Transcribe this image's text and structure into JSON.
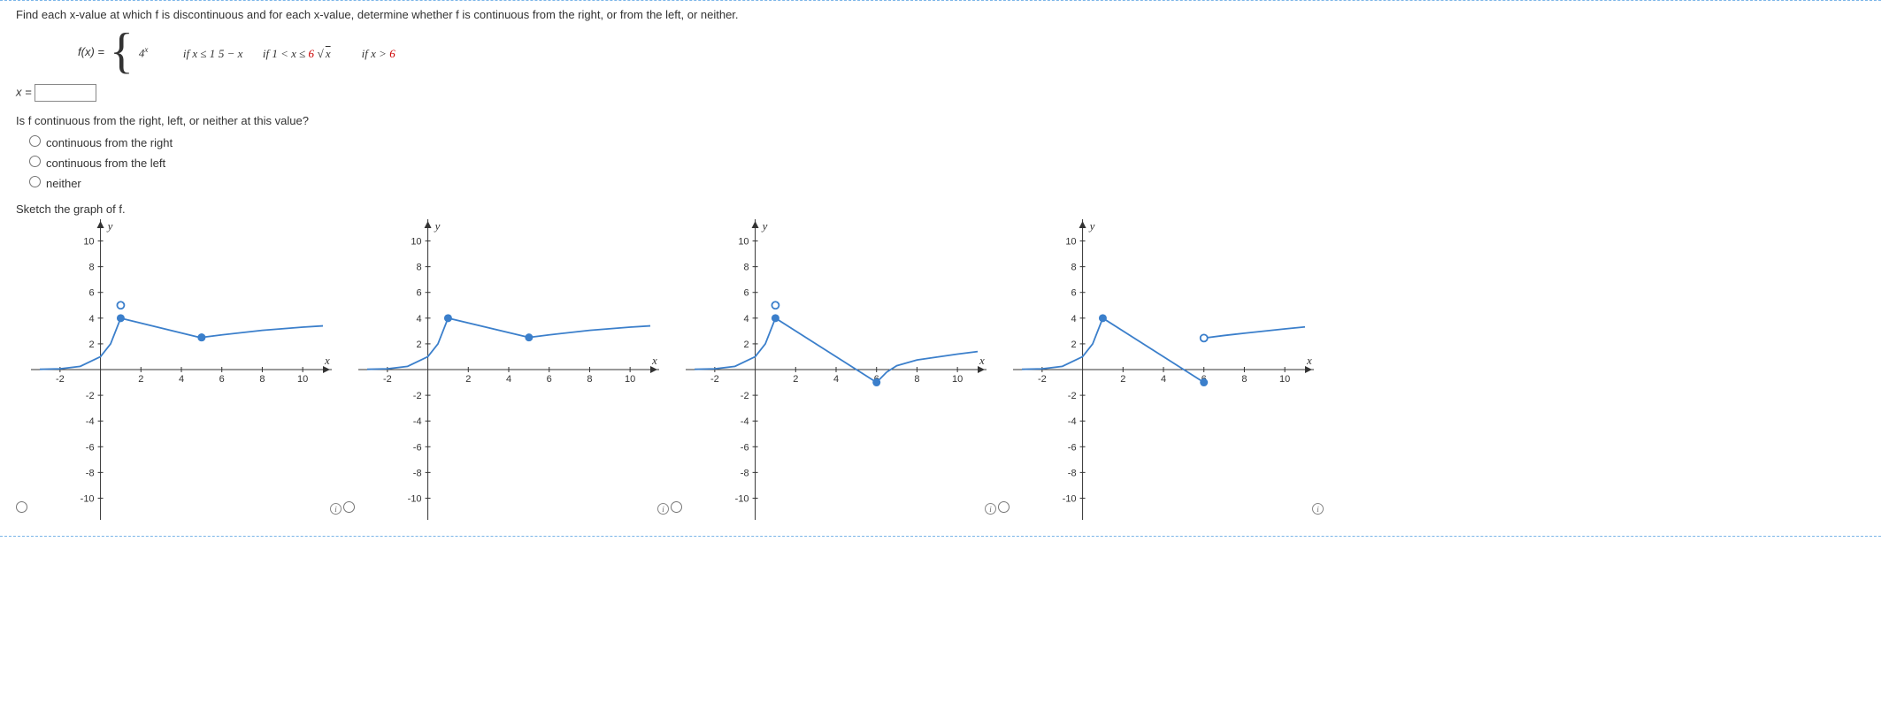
{
  "prompt": "Find each x-value at which f is discontinuous and for each x-value, determine whether f is continuous from the right, or from the left, or neither.",
  "function": {
    "label": "f(x) = ",
    "pieces": [
      {
        "expr_html": "4<span class='sup'>x</span>",
        "cond": "if x ≤ 1"
      },
      {
        "expr_html": "5 − x",
        "cond_html": "if 1 < x ≤ <span class='red'>6</span>"
      },
      {
        "expr_html": "√<span class='sqrt'>x</span>",
        "cond_html": "if x > <span class='red'>6</span>"
      }
    ]
  },
  "x_input": {
    "label": "x =",
    "value": ""
  },
  "continuity": {
    "question": "Is f continuous from the right, left, or neither at this value?",
    "options": [
      "continuous from the right",
      "continuous from the left",
      "neither"
    ]
  },
  "sketch_label": "Sketch the graph of f.",
  "axes": {
    "xticks": [
      -2,
      2,
      4,
      6,
      8,
      10
    ],
    "yticks": [
      -10,
      -8,
      -6,
      -4,
      -2,
      2,
      4,
      6,
      8,
      10
    ],
    "xlabel": "x",
    "ylabel": "y"
  },
  "chart_data": [
    {
      "type": "line",
      "description": "Option A",
      "xlim": [
        -3,
        11
      ],
      "ylim": [
        -11,
        11
      ],
      "series": [
        {
          "name": "4^x",
          "points": [
            [
              -3,
              0.02
            ],
            [
              -2,
              0.06
            ],
            [
              -1,
              0.25
            ],
            [
              0,
              1
            ],
            [
              0.5,
              2
            ],
            [
              1,
              4
            ]
          ],
          "end_open_at": [
            1,
            5
          ]
        },
        {
          "name": "5-x short",
          "points": [
            [
              1,
              4
            ],
            [
              4.9,
              2.5
            ]
          ],
          "start_closed": [
            1,
            4
          ],
          "end_closed": [
            5,
            2.5
          ]
        },
        {
          "name": "sqrt shifted",
          "points": [
            [
              5,
              2.5
            ],
            [
              6,
              2.7
            ],
            [
              8,
              3.05
            ],
            [
              10,
              3.3
            ],
            [
              11,
              3.4
            ]
          ],
          "start_closed": [
            5,
            2.5
          ]
        }
      ]
    },
    {
      "type": "line",
      "description": "Option B",
      "xlim": [
        -3,
        11
      ],
      "ylim": [
        -11,
        11
      ],
      "series": [
        {
          "name": "4^x",
          "points": [
            [
              -3,
              0.02
            ],
            [
              -2,
              0.06
            ],
            [
              -1,
              0.25
            ],
            [
              0,
              1
            ],
            [
              0.5,
              2
            ],
            [
              1,
              4
            ]
          ],
          "end_closed": [
            1,
            4
          ]
        },
        {
          "name": "5-x short",
          "points": [
            [
              1,
              4
            ],
            [
              5,
              2.5
            ]
          ],
          "end_closed": [
            5,
            2.5
          ]
        },
        {
          "name": "sqrt shifted",
          "points": [
            [
              5,
              2.5
            ],
            [
              6,
              2.7
            ],
            [
              8,
              3.05
            ],
            [
              10,
              3.3
            ],
            [
              11,
              3.4
            ]
          ]
        }
      ]
    },
    {
      "type": "line",
      "description": "Option C",
      "xlim": [
        -3,
        11
      ],
      "ylim": [
        -11,
        11
      ],
      "series": [
        {
          "name": "4^x",
          "points": [
            [
              -3,
              0.02
            ],
            [
              -2,
              0.06
            ],
            [
              -1,
              0.25
            ],
            [
              0,
              1
            ],
            [
              0.5,
              2
            ],
            [
              1,
              4
            ]
          ],
          "end_open_at": [
            1,
            5
          ]
        },
        {
          "name": "5-x",
          "points": [
            [
              1,
              4
            ],
            [
              6,
              -1
            ]
          ],
          "start_closed": [
            1,
            4
          ],
          "end_closed": [
            6,
            -1
          ]
        },
        {
          "name": "sqrt",
          "points": [
            [
              6,
              -1
            ],
            [
              6.5,
              -0.2
            ],
            [
              7,
              0.3
            ],
            [
              8,
              0.75
            ],
            [
              10,
              1.2
            ],
            [
              11,
              1.4
            ]
          ]
        }
      ]
    },
    {
      "type": "line",
      "description": "Option D",
      "xlim": [
        -3,
        11
      ],
      "ylim": [
        -11,
        11
      ],
      "series": [
        {
          "name": "4^x",
          "points": [
            [
              -3,
              0.02
            ],
            [
              -2,
              0.06
            ],
            [
              -1,
              0.25
            ],
            [
              0,
              1
            ],
            [
              0.5,
              2
            ],
            [
              1,
              4
            ]
          ],
          "end_closed": [
            1,
            4
          ]
        },
        {
          "name": "5-x",
          "points": [
            [
              1,
              4
            ],
            [
              6,
              -1
            ]
          ],
          "end_closed": [
            6,
            -1
          ]
        },
        {
          "name": "sqrt",
          "points": [
            [
              6,
              2.45
            ],
            [
              7,
              2.65
            ],
            [
              8,
              2.83
            ],
            [
              10,
              3.16
            ],
            [
              11,
              3.32
            ]
          ],
          "start_open": [
            6,
            2.45
          ]
        }
      ]
    }
  ]
}
